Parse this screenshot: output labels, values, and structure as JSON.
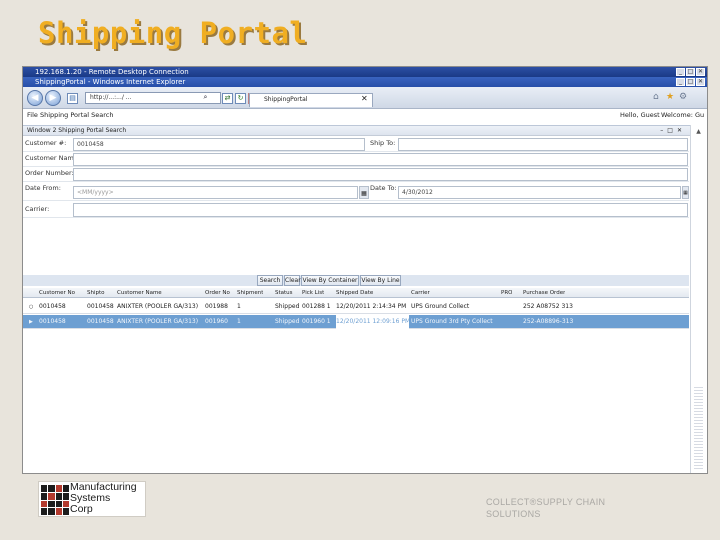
{
  "slide": {
    "title": "Shipping Portal",
    "footer_line1": "COLLECT®SUPPLY CHAIN",
    "footer_line2": "SOLUTIONS",
    "logo_lines": [
      "Manufacturing",
      "Systems",
      "Corp"
    ]
  },
  "rdp": {
    "title": "192.168.1.20 - Remote Desktop Connection"
  },
  "ie": {
    "title": "ShippingPortal - Windows Internet Explorer",
    "address": "http://...:.../ ...",
    "tab_label": "ShippingPortal",
    "menu_left": "File   Shipping Portal Search",
    "hello": "Hello, Guest",
    "welcome": "Welcome: Gu"
  },
  "window": {
    "title": "Window 2   Shipping Portal Search"
  },
  "form": {
    "customer_label": "Customer #:",
    "customer_value": "0010458",
    "ship_to_label": "Ship To:",
    "ship_to_value": "",
    "customer_name_label": "Customer Name:",
    "customer_name_value": "",
    "order_number_label": "Order Number:",
    "order_number_value": "",
    "date_from_label": "Date From:",
    "date_from_value": "<MM/yyyy>",
    "date_to_label": "Date To:",
    "date_to_value": "4/30/2012",
    "carrier_label": "Carrier:",
    "carrier_value": ""
  },
  "buttons": {
    "search": "Search",
    "clear": "Clear",
    "by_container": "View By Container",
    "by_line": "View By Line"
  },
  "grid": {
    "columns": [
      "Customer No",
      "Shipto",
      "Customer Name",
      "Order No",
      "Shipment",
      "Status",
      "Pick List",
      "Shipped Date",
      "Carrier",
      "PRO",
      "Purchase Order"
    ],
    "rows": [
      [
        "0010458",
        "0010458",
        "ANIXTER (POOLER GA/313)",
        "001988",
        "1",
        "Shipped",
        "001288 1",
        "12/20/2011 2:14:34 PM",
        "UPS Ground Collect",
        "",
        "252 A08752 313"
      ],
      [
        "0010458",
        "0010458",
        "ANIXTER (POOLER GA/313)",
        "001960",
        "1",
        "Shipped",
        "001960 1",
        "12/20/2011 12:09:16 PM",
        "UPS Ground 3rd Pty Collect",
        "",
        "252-A08896-313"
      ]
    ]
  },
  "colors": {
    "title": "#f0ae22",
    "selected_row": "#6d9fd2",
    "titlebar": "#2d4fa4"
  }
}
